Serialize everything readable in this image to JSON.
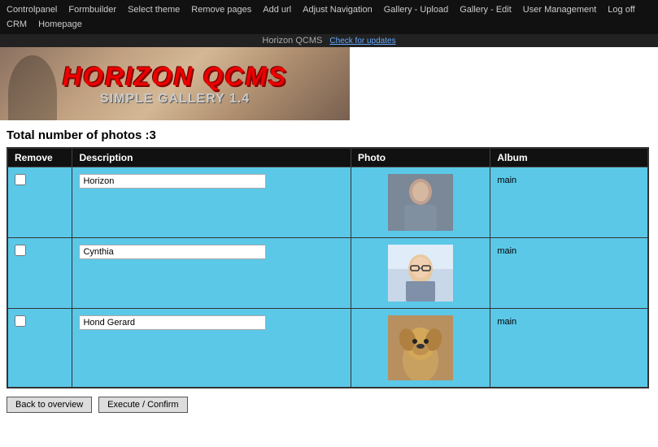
{
  "nav": {
    "items": [
      {
        "label": "Controlpanel",
        "name": "nav-controlpanel"
      },
      {
        "label": "Formbuilder",
        "name": "nav-formbuilder"
      },
      {
        "label": "Select theme",
        "name": "nav-select-theme"
      },
      {
        "label": "Remove pages",
        "name": "nav-remove-pages"
      },
      {
        "label": "Add url",
        "name": "nav-add-url"
      },
      {
        "label": "Adjust Navigation",
        "name": "nav-adjust-navigation"
      },
      {
        "label": "Gallery - Upload",
        "name": "nav-gallery-upload"
      },
      {
        "label": "Gallery - Edit",
        "name": "nav-gallery-edit"
      },
      {
        "label": "User Management",
        "name": "nav-user-management"
      },
      {
        "label": "Log off",
        "name": "nav-log-off"
      },
      {
        "label": "CRM",
        "name": "nav-crm"
      },
      {
        "label": "Homepage",
        "name": "nav-homepage"
      }
    ],
    "brand": "Horizon QCMS",
    "update_link": "Check for updates"
  },
  "banner": {
    "title": "HORIZON QCMS",
    "subtitle": "SIMPLE GALLERY 1.4"
  },
  "photo_count_label": "Total number of photos :3",
  "table": {
    "headers": [
      "Remove",
      "Description",
      "Photo",
      "Album"
    ],
    "rows": [
      {
        "description": "Horizon",
        "album": "main"
      },
      {
        "description": "Cynthia",
        "album": "main"
      },
      {
        "description": "Hond Gerard",
        "album": "main"
      }
    ]
  },
  "buttons": {
    "back": "Back to overview",
    "execute": "Execute / Confirm"
  }
}
